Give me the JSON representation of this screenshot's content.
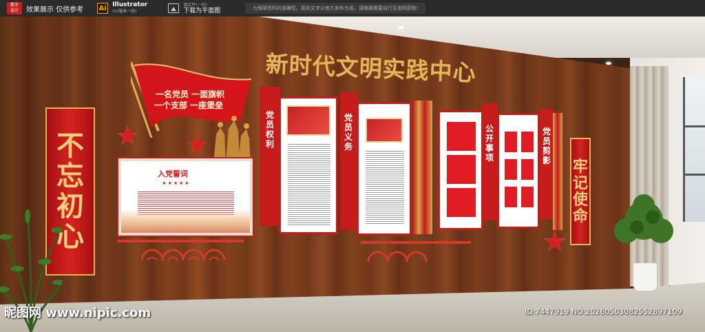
{
  "topbar": {
    "logo_text": "数字\n设计",
    "caption": "效果展示 仅供参考",
    "app_badge": "Ai",
    "app_name": "Illustrator",
    "app_sub": "(cc版本一份)",
    "download_top": "源文件(一份)",
    "download_label": "下载为平面图",
    "notice": "为保障资料的准确性，相关文字以官方发布为准，请根据需要自行至官网获取!"
  },
  "scene": {
    "title": "新时代文明实践中心",
    "left_banner": [
      "不",
      "忘",
      "初",
      "心"
    ],
    "right_banner": [
      "牢",
      "记",
      "使",
      "命"
    ],
    "flag_line1": "一名党员  一面旗帜",
    "flag_line2": "一个支部  一座堡垒",
    "oath_title": "入党誓词",
    "oath_stars": "★★★★★",
    "panel_labels": {
      "rights": [
        "党",
        "员",
        "权",
        "利"
      ],
      "duties": [
        "党",
        "员",
        "义",
        "务"
      ],
      "public": [
        "公",
        "开",
        "事",
        "项"
      ],
      "photos": [
        "党",
        "员",
        "剪",
        "影"
      ]
    }
  },
  "watermark": {
    "site": "昵图网 www.nipic.com",
    "id": "ID:7447919 NO:20260503082552897109"
  },
  "colors": {
    "party_red": "#c41b1b",
    "gold": "#e4b55d",
    "wood": "#7a3c1d"
  }
}
